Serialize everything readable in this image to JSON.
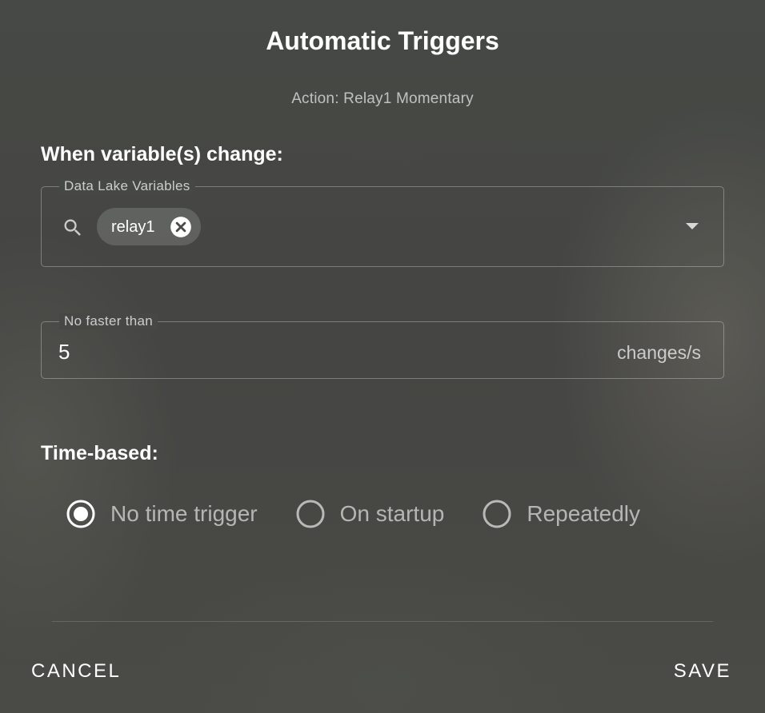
{
  "dialog": {
    "title": "Automatic Triggers",
    "subtitle": "Action: Relay1 Momentary"
  },
  "variables_section": {
    "heading": "When variable(s) change:",
    "field": {
      "label": "Data Lake Variables",
      "chips": [
        {
          "label": "relay1"
        }
      ],
      "icon": "search-icon",
      "dropdown_icon": "arrow-drop-down-icon"
    }
  },
  "rate_field": {
    "label": "No faster than",
    "value": "5",
    "suffix": "changes/s"
  },
  "time_section": {
    "heading": "Time-based:",
    "options": [
      {
        "label": "No time trigger",
        "selected": true
      },
      {
        "label": "On startup",
        "selected": false
      },
      {
        "label": "Repeatedly",
        "selected": false
      }
    ]
  },
  "footer": {
    "cancel_label": "CANCEL",
    "save_label": "SAVE"
  },
  "colors": {
    "text": "#ffffff",
    "muted_text": "rgba(255,255,255,0.6)",
    "outline": "rgba(255,255,255,0.3)",
    "background": "#464845"
  }
}
